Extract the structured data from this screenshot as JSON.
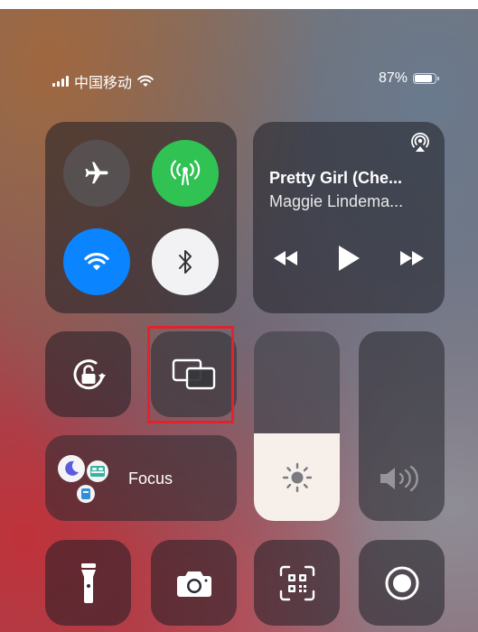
{
  "status_bar": {
    "carrier": "中国移动",
    "battery_text": "87%",
    "battery_fraction": 0.87
  },
  "connectivity": {
    "airplane_icon": "airplane-icon",
    "cellular_icon": "cellular-antenna-icon",
    "cellular_color": "#30c354",
    "wifi_icon": "wifi-icon",
    "wifi_color": "#0a84ff",
    "bluetooth_icon": "bluetooth-icon"
  },
  "now_playing": {
    "title": "Pretty Girl (Che...",
    "artist": "Maggie Lindema...",
    "airplay_icon": "airplay-audio-icon",
    "controls": [
      "rewind-icon",
      "play-icon",
      "fast-forward-icon"
    ]
  },
  "tiles": {
    "orientation_lock_icon": "orientation-lock-icon",
    "screen_mirroring_icon": "screen-mirroring-icon",
    "highlight_color": "#e0232c"
  },
  "focus": {
    "label": "Focus",
    "icons": [
      "moon-icon",
      "bed-icon",
      "work-badge-icon"
    ]
  },
  "sliders": {
    "brightness_level": 0.46,
    "brightness_icon": "sun-icon",
    "volume_level": 0,
    "volume_icon": "speaker-volume-icon"
  },
  "bottom_row": [
    "flashlight-icon",
    "camera-icon",
    "qr-code-scanner-icon",
    "screen-record-icon"
  ]
}
